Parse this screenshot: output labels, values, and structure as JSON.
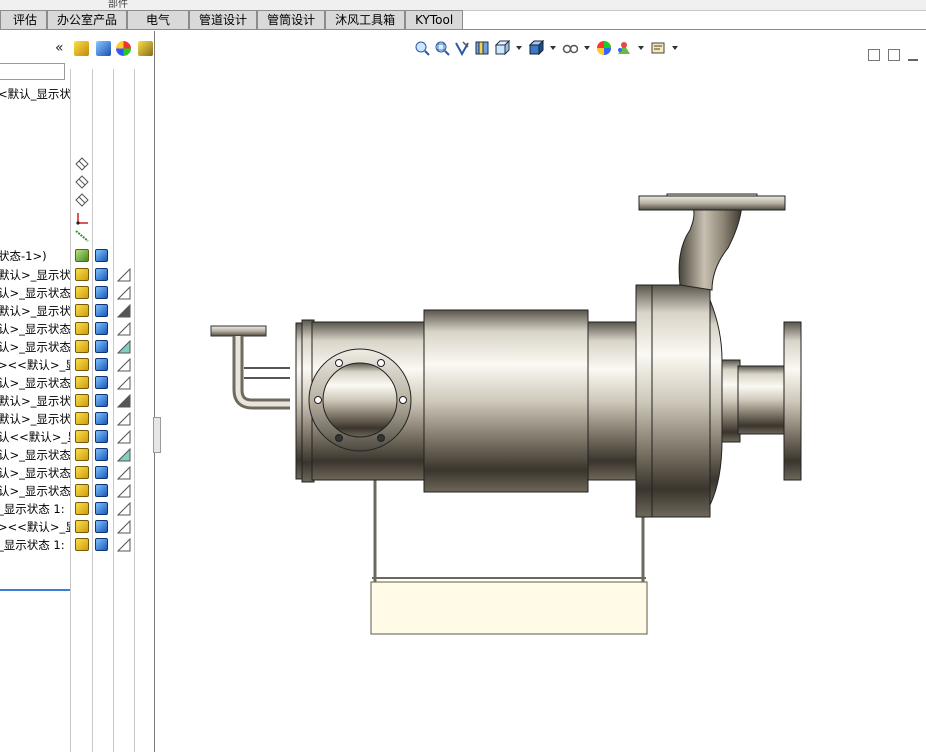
{
  "menu_tabs": [
    "评估",
    "办公室产品",
    "电气",
    "管道设计",
    "管筒设计",
    "沐风工具箱",
    "KYTool"
  ],
  "top_strip_fragment": "部件",
  "panel": {
    "collapse_glyph": "«",
    "config_row_1": "<默认_显示状",
    "config_row_top": "状态-1>)",
    "rows": [
      "默认>_显示状",
      "认>_显示状态",
      "默认>_显示状",
      "认>_显示状态",
      "认>_显示状态",
      "><<默认>_显",
      "认>_显示状态",
      "默认>_显示状",
      "默认>_显示状",
      "认<<默认>_显",
      "认>_显示状态",
      "认>_显示状态",
      "认>_显示状态",
      "_显示状态 1:",
      "><<默认>_显",
      "_显示状态 1:"
    ]
  },
  "viewport_icons": [
    "zoom-to-fit-icon",
    "zoom-area-icon",
    "previous-view-icon",
    "section-view-icon",
    "view-orientation-icon",
    "display-style-icon",
    "hide-show-icon",
    "edit-appearance-icon",
    "apply-scene-icon",
    "view-settings-icon"
  ],
  "colors": {
    "accent": "#3b7ed8",
    "metal_light": "#f4f1ea",
    "metal_dark": "#3c3830",
    "base": "#fffbe6"
  }
}
